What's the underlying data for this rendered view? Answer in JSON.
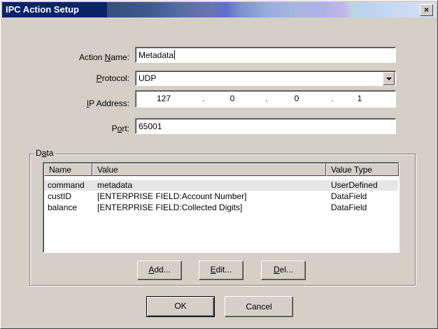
{
  "window": {
    "title": "IPC Action Setup",
    "close_label": "×"
  },
  "form": {
    "action_name": {
      "label_mnemonic": "N",
      "label_pre": "Action ",
      "label_post": "ame:",
      "value": "Metadata"
    },
    "protocol": {
      "label_mnemonic": "P",
      "label_pre": "",
      "label_post": "rotocol:",
      "value": "UDP"
    },
    "ip_address": {
      "label_mnemonic": "I",
      "label_pre": "",
      "label_post": "P Address:",
      "octets": [
        "127",
        "0",
        "0",
        "1"
      ],
      "separator": "."
    },
    "port": {
      "label_mnemonic": "o",
      "label_pre": "P",
      "label_post": "rt:",
      "value": "65001"
    }
  },
  "data_group": {
    "title_pre": "D",
    "title_mnemonic": "a",
    "title_post": "ta",
    "columns": [
      "Name",
      "Value",
      "Value Type"
    ],
    "rows": [
      {
        "name": "command",
        "value": "metadata",
        "type": "UserDefined",
        "selected": true
      },
      {
        "name": "custID",
        "value": "[ENTERPRISE FIELD:Account Number]",
        "type": "DataField",
        "selected": false
      },
      {
        "name": "balance",
        "value": "[ENTERPRISE FIELD:Collected Digits]",
        "type": "DataField",
        "selected": false
      }
    ],
    "buttons": {
      "add": {
        "mnemonic": "A",
        "rest": "dd..."
      },
      "edit": {
        "mnemonic": "E",
        "rest": "dit..."
      },
      "del": {
        "mnemonic": "D",
        "rest": "el..."
      }
    }
  },
  "footer": {
    "ok_label": "OK",
    "cancel_label": "Cancel"
  }
}
